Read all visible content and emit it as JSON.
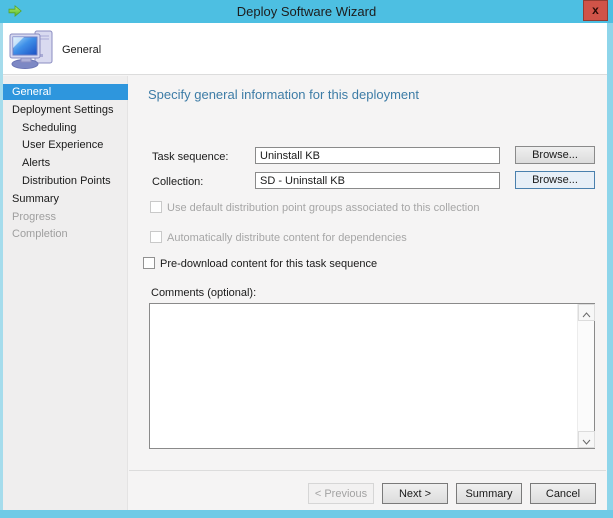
{
  "window": {
    "title": "Deploy Software Wizard",
    "close_label": "x"
  },
  "header": {
    "title": "General"
  },
  "sidebar": {
    "items": [
      {
        "label": "General",
        "level": 0,
        "state": "selected"
      },
      {
        "label": "Deployment Settings",
        "level": 0,
        "state": "normal"
      },
      {
        "label": "Scheduling",
        "level": 1,
        "state": "normal"
      },
      {
        "label": "User Experience",
        "level": 1,
        "state": "normal"
      },
      {
        "label": "Alerts",
        "level": 1,
        "state": "normal"
      },
      {
        "label": "Distribution Points",
        "level": 1,
        "state": "normal"
      },
      {
        "label": "Summary",
        "level": 0,
        "state": "normal"
      },
      {
        "label": "Progress",
        "level": 0,
        "state": "disabled"
      },
      {
        "label": "Completion",
        "level": 0,
        "state": "disabled"
      }
    ]
  },
  "main": {
    "heading": "Specify general information for this deployment",
    "fields": [
      {
        "label": "Task sequence:",
        "value": "Uninstall KB",
        "button": "Browse..."
      },
      {
        "label": "Collection:",
        "value": "SD - Uninstall KB",
        "button": "Browse...",
        "focused": true
      }
    ],
    "checkboxes": [
      {
        "label": "Use default distribution point groups associated to this collection",
        "checked": false,
        "disabled": true
      },
      {
        "label": "Automatically distribute content for dependencies",
        "checked": false,
        "disabled": true
      },
      {
        "label": "Pre-download content for this task sequence",
        "checked": false,
        "disabled": false
      }
    ],
    "comments": {
      "label": "Comments (optional):",
      "value": ""
    }
  },
  "footer": {
    "buttons": [
      {
        "label": "< Previous",
        "disabled": true
      },
      {
        "label": "Next >",
        "disabled": false
      },
      {
        "label": "Summary",
        "disabled": false
      },
      {
        "label": "Cancel",
        "disabled": false
      }
    ]
  },
  "colors": {
    "titlebar": "#4dbfe2",
    "selected_blue": "#2e96dd",
    "heading_blue": "#3d7ca6",
    "close_red": "#d05348"
  }
}
